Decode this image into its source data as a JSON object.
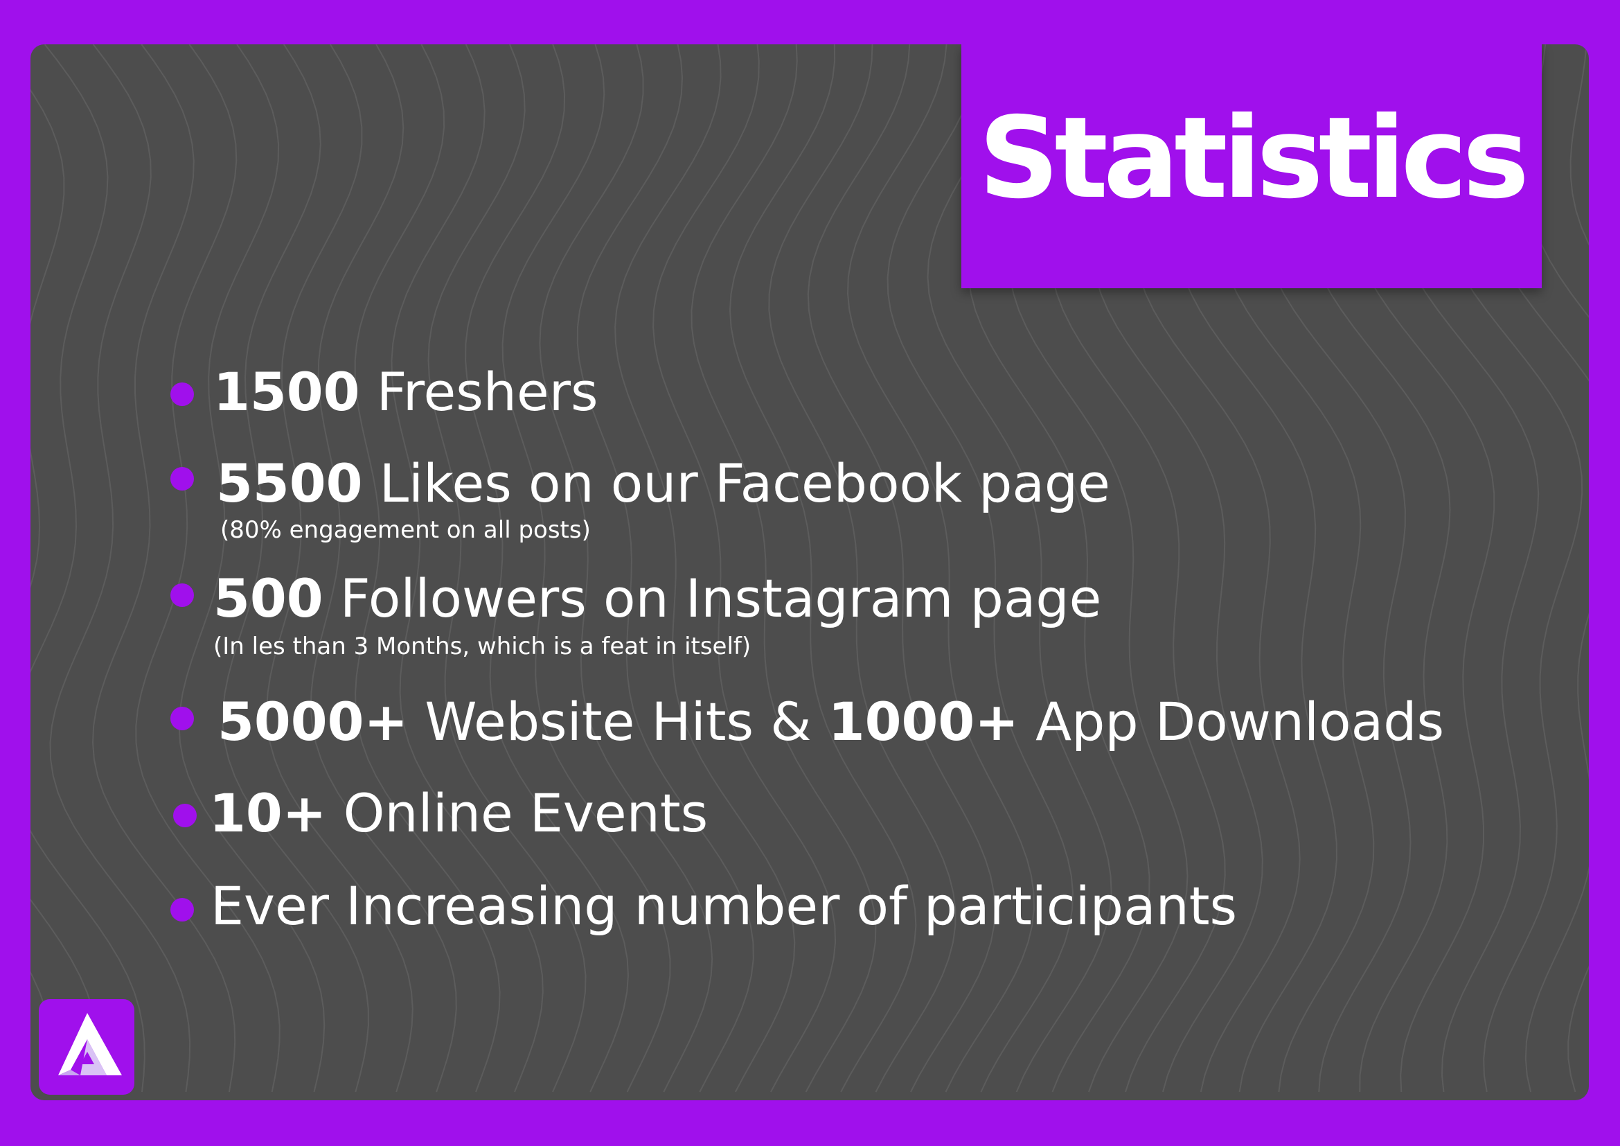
{
  "heading": "Statistics",
  "stats": [
    {
      "number": "1500",
      "text": " Freshers"
    },
    {
      "number": "5500",
      "text": " Likes on our Facebook page",
      "note": "(80% engagement on all posts)"
    },
    {
      "number": "500",
      "text": " Followers on Instagram page",
      "note": "(In les than 3 Months, which is a feat in itself)"
    },
    {
      "number": "5000+",
      "text": " Website Hits & ",
      "number2": "1000+",
      "text2": " App Downloads"
    },
    {
      "number": "10+",
      "text": " Online Events"
    },
    {
      "text": "Ever Increasing number of participants"
    }
  ],
  "colors": {
    "accent": "#a010ec",
    "panel": "#4d4d4d",
    "text": "#ffffff"
  },
  "logo_icon": "a-logo-icon"
}
